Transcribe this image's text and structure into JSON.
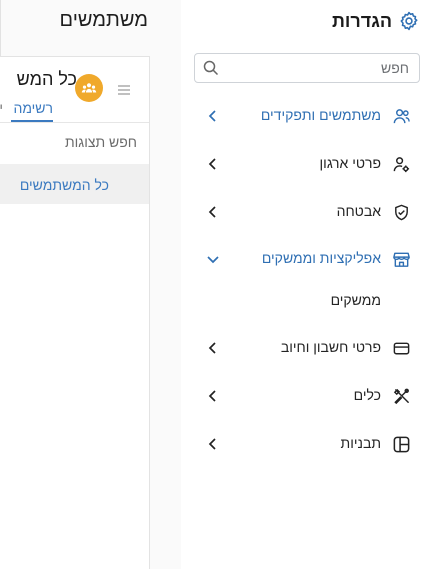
{
  "settings": {
    "title": "הגדרות",
    "icon": "gear-icon",
    "accent_color": "#2f6fb3",
    "search_placeholder": "חפש",
    "items": [
      {
        "label": "משתמשים ותפקידים",
        "icon": "users-icon",
        "state": "collapsed",
        "active": true
      },
      {
        "label": "פרטי ארגון",
        "icon": "org-settings-icon",
        "state": "collapsed",
        "active": false
      },
      {
        "label": "אבטחה",
        "icon": "shield-icon",
        "state": "collapsed",
        "active": false
      },
      {
        "label": "אפליקציות וממשקים",
        "icon": "store-icon",
        "state": "expanded",
        "active": true,
        "children": [
          {
            "label": "ממשקים"
          }
        ]
      },
      {
        "label": "פרטי חשבון וחיוב",
        "icon": "credit-card-icon",
        "state": "collapsed",
        "active": false
      },
      {
        "label": "כלים",
        "icon": "tools-icon",
        "state": "collapsed",
        "active": false
      },
      {
        "label": "תבניות",
        "icon": "template-icon",
        "state": "collapsed",
        "active": false
      }
    ]
  },
  "users_panel": {
    "title": "משתמשים",
    "card_heading": "כל המש",
    "avatar_color": "#f0a92b",
    "tabs": [
      {
        "label": "רשימה",
        "active": true
      },
      {
        "label": "י"
      }
    ],
    "view_search_placeholder": "חפש תצוגות",
    "selected_view": "כל המשתמשים"
  }
}
